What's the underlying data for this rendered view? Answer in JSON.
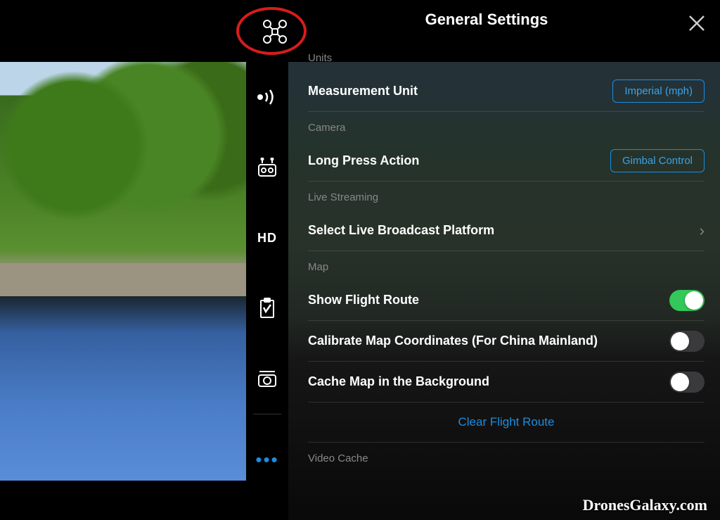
{
  "header": {
    "title": "General Settings"
  },
  "sidebar": {
    "hd_label": "HD"
  },
  "sections": {
    "units": {
      "label": "Units",
      "measurement_unit": {
        "label": "Measurement Unit",
        "value": "Imperial (mph)"
      }
    },
    "camera": {
      "label": "Camera",
      "long_press": {
        "label": "Long Press Action",
        "value": "Gimbal Control"
      }
    },
    "live": {
      "label": "Live Streaming",
      "select_platform": {
        "label": "Select Live Broadcast Platform"
      }
    },
    "map": {
      "label": "Map",
      "show_route": {
        "label": "Show Flight Route",
        "on": true
      },
      "calibrate": {
        "label": "Calibrate Map Coordinates (For China Mainland)",
        "on": false
      },
      "cache": {
        "label": "Cache Map in the Background",
        "on": false
      },
      "clear_route": {
        "label": "Clear Flight Route"
      }
    },
    "video_cache": {
      "label": "Video Cache"
    }
  },
  "watermark": "DronesGalaxy.com"
}
